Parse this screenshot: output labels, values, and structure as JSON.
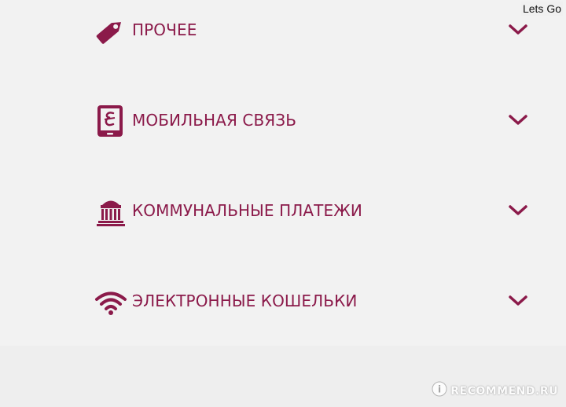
{
  "corner_text": "Lets Go",
  "categories": [
    {
      "label": "ПРОЧЕЕ",
      "icon": "tag-icon"
    },
    {
      "label": "МОБИЛЬНАЯ СВЯЗЬ",
      "icon": "mobile-phone-icon"
    },
    {
      "label": "КОММУНАЛЬНЫЕ ПЛАТЕЖИ",
      "icon": "building-icon"
    },
    {
      "label": "ЭЛЕКТРОННЫЕ КОШЕЛЬКИ",
      "icon": "wifi-icon"
    }
  ],
  "watermark": "RECOMMEND.RU",
  "colors": {
    "accent": "#8b1a4a",
    "background": "#f2f2f2"
  }
}
